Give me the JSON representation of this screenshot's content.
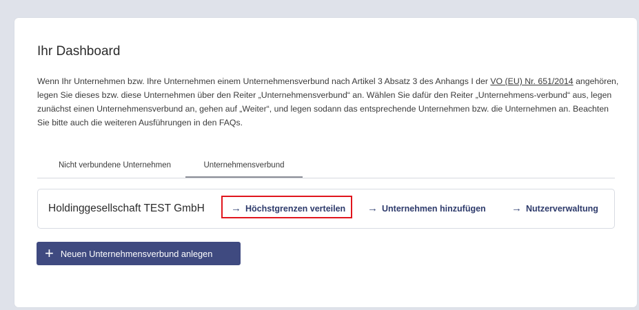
{
  "dashboard": {
    "title": "Ihr Dashboard",
    "intro_part1": "Wenn Ihr Unternehmen bzw. Ihre Unternehmen einem Unternehmensverbund nach Artikel 3 Absatz 3 des Anhangs I der ",
    "intro_link": "VO (EU) Nr. 651/2014",
    "intro_part2": " angehören, legen Sie dieses bzw. diese Unternehmen über den Reiter „Unternehmensverbund“ an. Wählen Sie dafür den Reiter „Unternehmens-verbund“ aus, legen zunächst einen Unternehmensverbund an, gehen auf „Weiter“, und legen sodann das entsprechende Unternehmen bzw. die Unternehmen an. Beachten Sie bitte auch die weiteren Ausführungen in den FAQs."
  },
  "tabs": [
    {
      "label": "Nicht verbundene Unternehmen"
    },
    {
      "label": "Unternehmensverbund",
      "active": true
    }
  ],
  "group": {
    "name": "Holdinggesellschaft TEST GmbH",
    "actions": [
      {
        "icon": "arrow-right-icon",
        "arrow": "→",
        "label": "Höchstgrenzen verteilen",
        "highlighted": true
      },
      {
        "icon": "arrow-right-icon",
        "arrow": "→",
        "label": "Unternehmen hinzufügen"
      },
      {
        "icon": "arrow-right-icon",
        "arrow": "→",
        "label": "Nutzerverwaltung"
      }
    ]
  },
  "new_group_button": {
    "icon": "plus-icon",
    "plus": "+",
    "label": "Neuen Unternehmensverbund anlegen"
  },
  "colors": {
    "page_bg": "#dfe2ea",
    "primary": "#3f4a80",
    "action_text": "#2d3a6b",
    "highlight": "#e0141c"
  }
}
